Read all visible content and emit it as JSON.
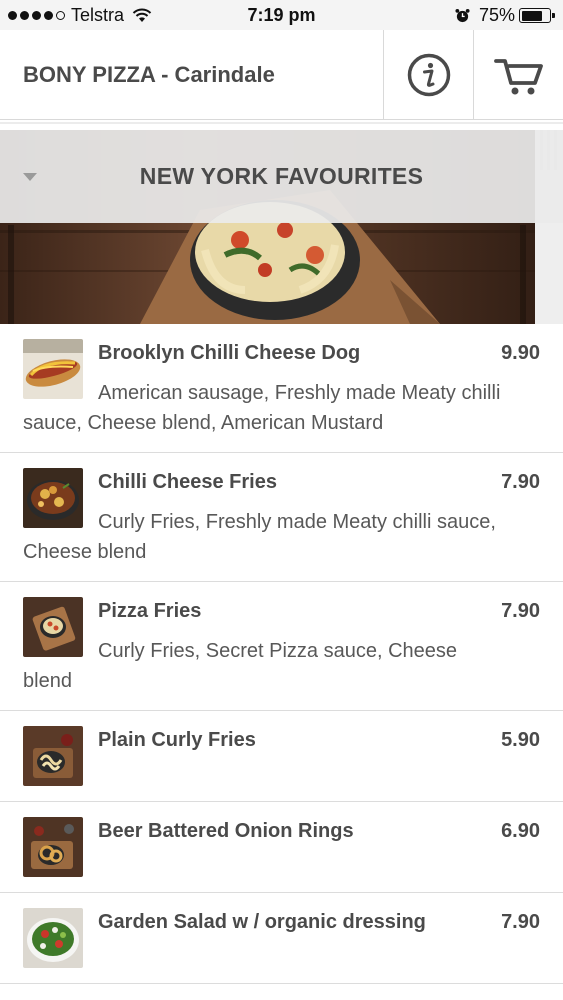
{
  "status_bar": {
    "carrier": "Telstra",
    "time": "7:19 pm",
    "battery_percent_label": "75%",
    "battery_level": 0.75
  },
  "header": {
    "title": "BONY PIZZA - Carindale",
    "info_icon": "info-circle-icon",
    "cart_icon": "shopping-cart-icon"
  },
  "category": {
    "title": "NEW YORK FAVOURITES",
    "expanded": true
  },
  "menu_items": [
    {
      "name": "Brooklyn Chilli Cheese Dog",
      "price": "9.90",
      "description": "American sausage, Freshly made Meaty chilli sauce, Cheese blend, American Mustard",
      "image": "hot-dog-photo"
    },
    {
      "name": "Chilli Cheese Fries",
      "price": "7.90",
      "description": "Curly Fries, Freshly made Meaty chilli sauce, Cheese blend",
      "image": "chilli-fries-photo"
    },
    {
      "name": "Pizza Fries",
      "price": "7.90",
      "description": "Curly Fries, Secret Pizza sauce, Cheese blend",
      "image": "pizza-fries-photo"
    },
    {
      "name": "Plain Curly Fries",
      "price": "5.90",
      "description": "",
      "image": "curly-fries-photo"
    },
    {
      "name": "Beer Battered Onion Rings",
      "price": "6.90",
      "description": "",
      "image": "onion-rings-photo"
    },
    {
      "name": "Garden Salad w / organic dressing",
      "price": "7.90",
      "description": "",
      "image": "garden-salad-photo"
    }
  ],
  "colors": {
    "text": "#4a4a4a",
    "divider": "#dcdcdc",
    "banner_overlay": "#ebebeb",
    "status_bar_bg": "#f4f4f4"
  }
}
